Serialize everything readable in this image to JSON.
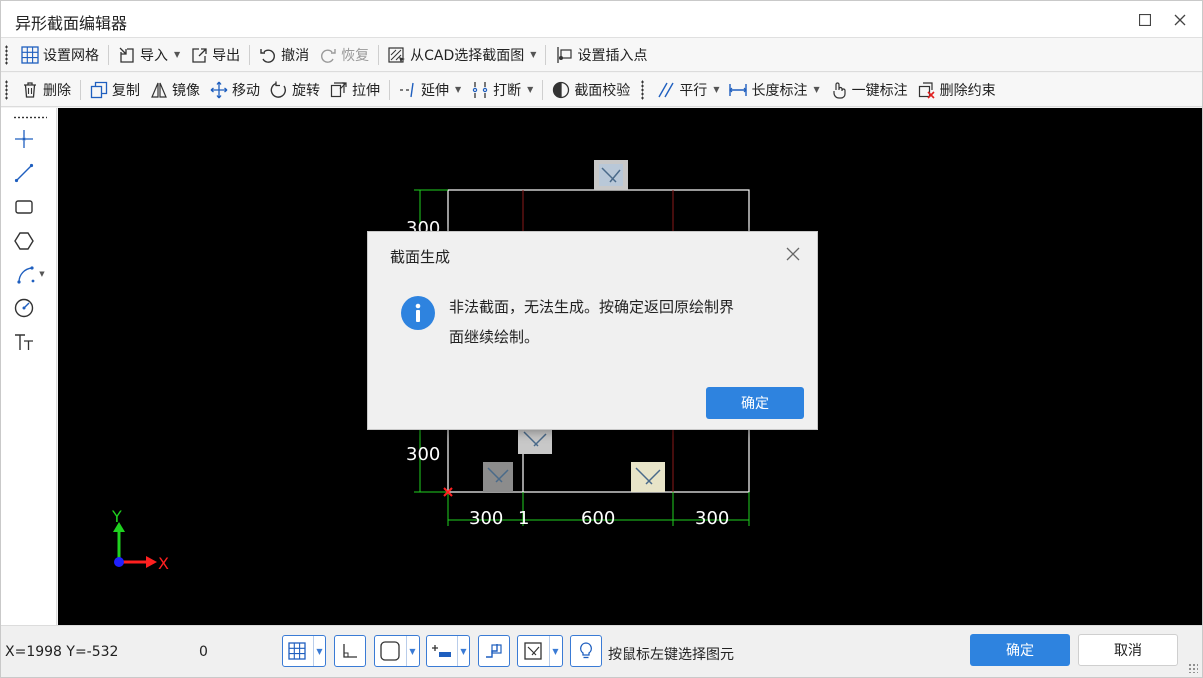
{
  "window": {
    "title": "异形截面编辑器"
  },
  "toolbar1": {
    "items": [
      {
        "label": "设置网格",
        "icon": "grid-icon"
      },
      {
        "label": "导入",
        "icon": "import-icon"
      },
      {
        "label": "导出",
        "icon": "export-icon"
      },
      {
        "label": "撤消",
        "icon": "undo-icon"
      },
      {
        "label": "恢复",
        "icon": "redo-icon"
      },
      {
        "label": "从CAD选择截面图",
        "icon": "cad-select-icon"
      },
      {
        "label": "设置插入点",
        "icon": "insert-point-icon"
      }
    ]
  },
  "toolbar2": {
    "items": [
      {
        "label": "删除",
        "icon": "trash-icon"
      },
      {
        "label": "复制",
        "icon": "copy-icon"
      },
      {
        "label": "镜像",
        "icon": "mirror-icon"
      },
      {
        "label": "移动",
        "icon": "move-icon"
      },
      {
        "label": "旋转",
        "icon": "rotate-icon"
      },
      {
        "label": "拉伸",
        "icon": "stretch-icon"
      },
      {
        "label": "延伸",
        "icon": "extend-icon"
      },
      {
        "label": "打断",
        "icon": "break-icon"
      },
      {
        "label": "截面校验",
        "icon": "section-check-icon"
      },
      {
        "label": "平行",
        "icon": "parallel-icon"
      },
      {
        "label": "长度标注",
        "icon": "length-dimension-icon"
      },
      {
        "label": "一键标注",
        "icon": "one-click-dimension-icon"
      },
      {
        "label": "删除约束",
        "icon": "delete-constraint-icon"
      }
    ]
  },
  "canvas": {
    "dimensions": {
      "left_top": "300",
      "left_bottom": "300",
      "bottom_1": "300",
      "bottom_2": "1",
      "bottom_3": "600",
      "bottom_4": "300"
    },
    "axis": {
      "y_label": "Y",
      "x_label": "X"
    },
    "colors": {
      "dimension": "#1fd11f",
      "outline": "#ffffff",
      "centerline": "#8b1a1a",
      "axis_y": "#1fd11f",
      "axis_x": "#ff2020"
    }
  },
  "dialog": {
    "title": "截面生成",
    "message_line1": "非法截面，无法生成。按确定返回原绘制界",
    "message_line2": "面继续绘制。",
    "ok_label": "确定",
    "icon": "info-icon"
  },
  "statusbar": {
    "coordinates": "X=1998 Y=-532",
    "value": "0",
    "hint": "按鼠标左键选择图元",
    "ok_label": "确定",
    "cancel_label": "取消"
  },
  "colors": {
    "accent": "#2e83df",
    "canvas_bg": "#000000"
  }
}
